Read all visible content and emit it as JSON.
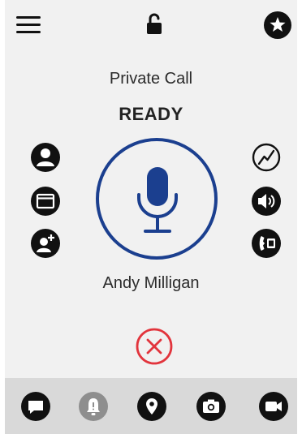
{
  "header": {
    "menu_icon": "hamburger-menu-icon",
    "lock_icon": "unlocked-padlock-icon",
    "star_icon": "star-icon"
  },
  "call": {
    "type": "Private Call",
    "status": "READY",
    "contact_name": "Andy Milligan",
    "ptt_icon": "microphone-icon",
    "end_icon": "close-circle-icon"
  },
  "left_actions": [
    {
      "icon": "contact-person-icon"
    },
    {
      "icon": "folder-icon"
    },
    {
      "icon": "add-contact-icon"
    }
  ],
  "right_actions": [
    {
      "icon": "signal-trend-icon"
    },
    {
      "icon": "speaker-volume-icon"
    },
    {
      "icon": "phone-handset-icon"
    }
  ],
  "bottom_bar": [
    {
      "icon": "chat-bubble-icon"
    },
    {
      "icon": "alert-bell-icon"
    },
    {
      "icon": "location-pin-icon"
    },
    {
      "icon": "camera-icon"
    },
    {
      "icon": "video-camera-icon"
    }
  ],
  "colors": {
    "accent_blue": "#1b3f8f",
    "end_red": "#e2343c",
    "icon_black": "#111111",
    "bell_grey": "#8e8e8e",
    "background": "#f1f1f1",
    "bottom_bar": "#d9d9d9"
  }
}
